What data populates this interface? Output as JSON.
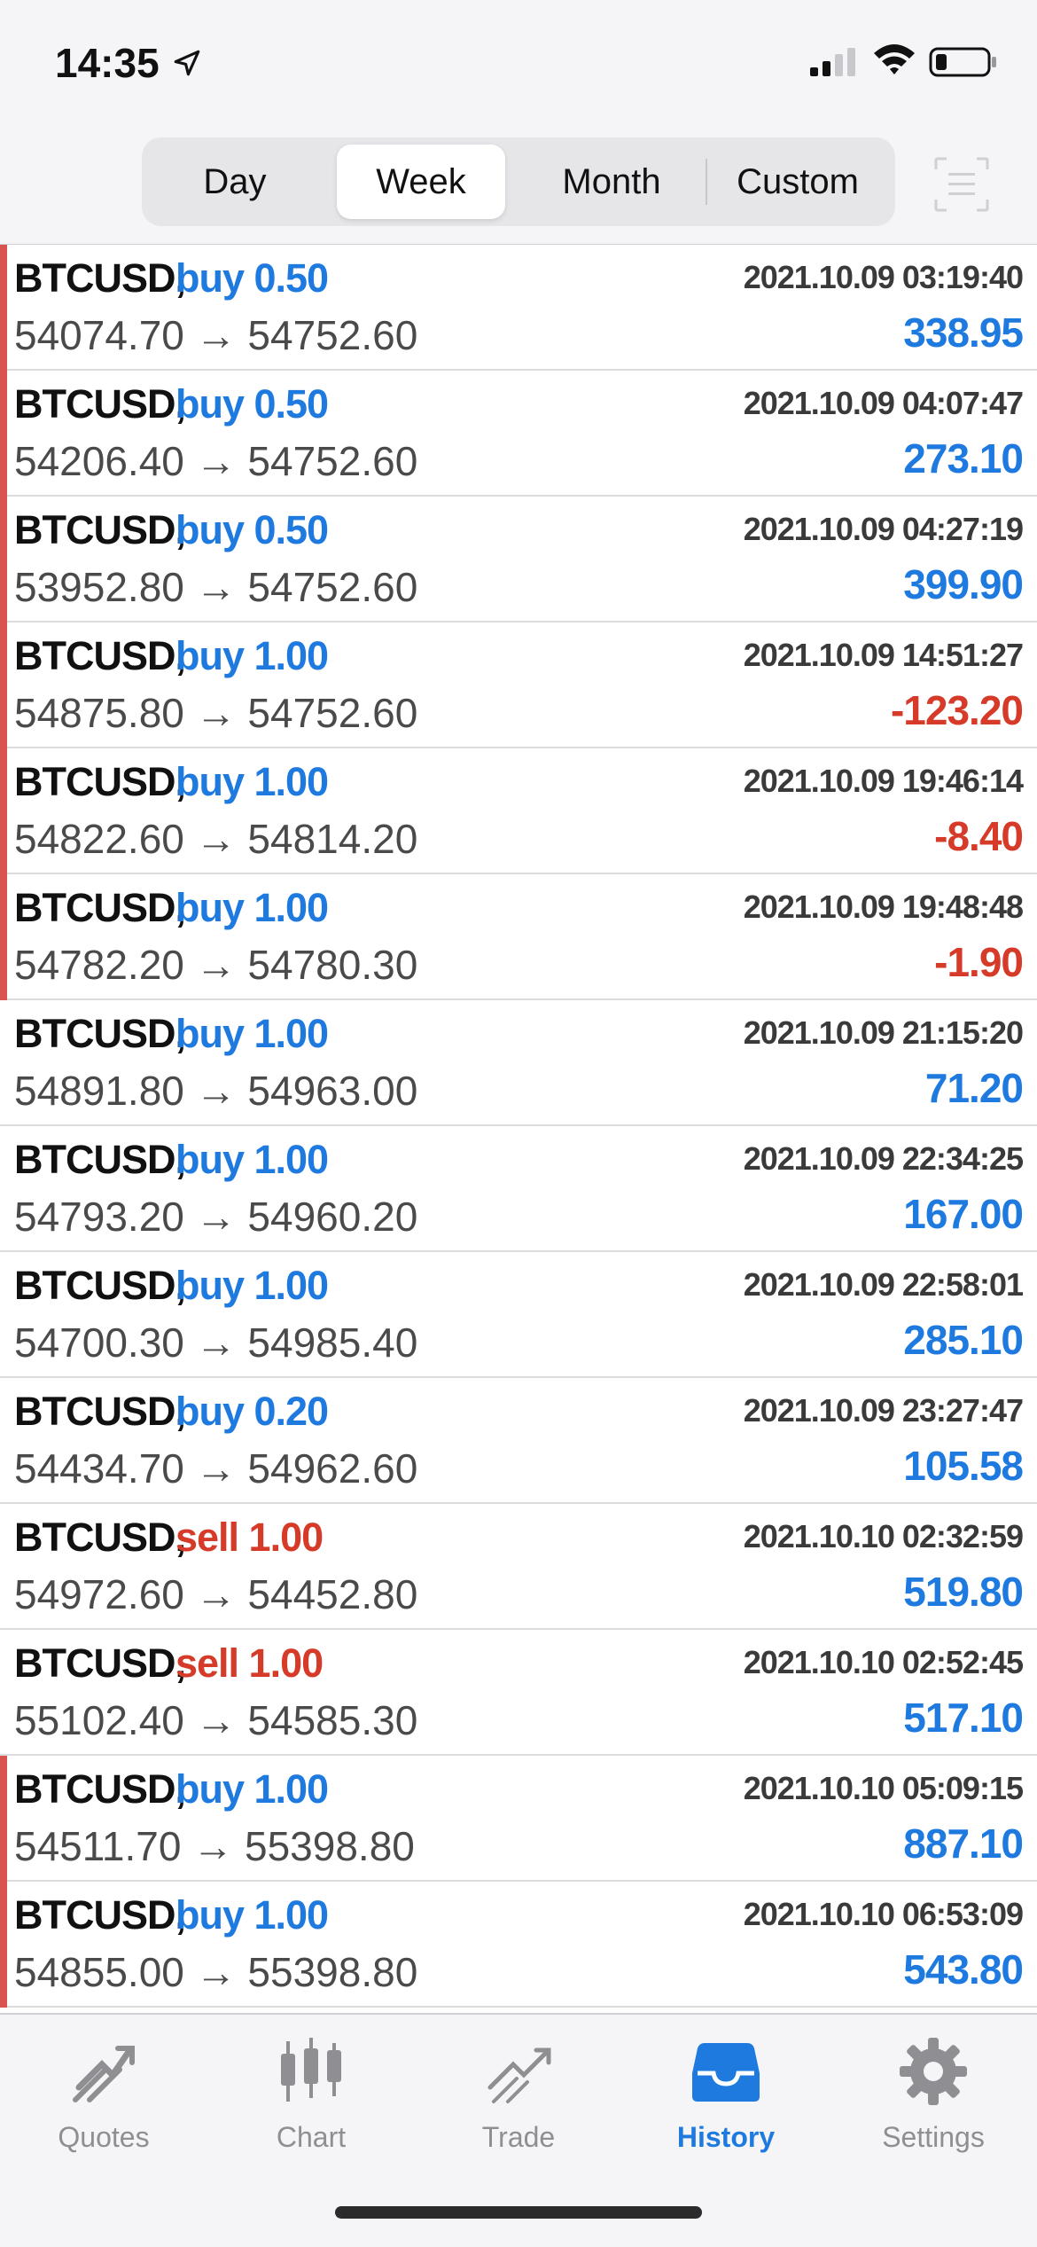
{
  "status_bar": {
    "time": "14:35"
  },
  "period_tabs": [
    {
      "label": "Day",
      "active": false
    },
    {
      "label": "Week",
      "active": true
    },
    {
      "label": "Month",
      "active": false
    },
    {
      "label": "Custom",
      "active": false
    }
  ],
  "deals": [
    {
      "symbol": "BTCUSD,",
      "type": "buy 0.50",
      "side": "buy",
      "prices": "54074.70 → 54752.60",
      "time": "2021.10.09 03:19:40",
      "profit": "338.95",
      "marker": true
    },
    {
      "symbol": "BTCUSD,",
      "type": "buy 0.50",
      "side": "buy",
      "prices": "54206.40 → 54752.60",
      "time": "2021.10.09 04:07:47",
      "profit": "273.10",
      "marker": true
    },
    {
      "symbol": "BTCUSD,",
      "type": "buy 0.50",
      "side": "buy",
      "prices": "53952.80 → 54752.60",
      "time": "2021.10.09 04:27:19",
      "profit": "399.90",
      "marker": true
    },
    {
      "symbol": "BTCUSD,",
      "type": "buy 1.00",
      "side": "buy",
      "prices": "54875.80 → 54752.60",
      "time": "2021.10.09 14:51:27",
      "profit": "-123.20",
      "marker": true
    },
    {
      "symbol": "BTCUSD,",
      "type": "buy 1.00",
      "side": "buy",
      "prices": "54822.60 → 54814.20",
      "time": "2021.10.09 19:46:14",
      "profit": "-8.40",
      "marker": true
    },
    {
      "symbol": "BTCUSD,",
      "type": "buy 1.00",
      "side": "buy",
      "prices": "54782.20 → 54780.30",
      "time": "2021.10.09 19:48:48",
      "profit": "-1.90",
      "marker": true
    },
    {
      "symbol": "BTCUSD,",
      "type": "buy 1.00",
      "side": "buy",
      "prices": "54891.80 → 54963.00",
      "time": "2021.10.09 21:15:20",
      "profit": "71.20",
      "marker": false
    },
    {
      "symbol": "BTCUSD,",
      "type": "buy 1.00",
      "side": "buy",
      "prices": "54793.20 → 54960.20",
      "time": "2021.10.09 22:34:25",
      "profit": "167.00",
      "marker": false
    },
    {
      "symbol": "BTCUSD,",
      "type": "buy 1.00",
      "side": "buy",
      "prices": "54700.30 → 54985.40",
      "time": "2021.10.09 22:58:01",
      "profit": "285.10",
      "marker": false
    },
    {
      "symbol": "BTCUSD,",
      "type": "buy 0.20",
      "side": "buy",
      "prices": "54434.70 → 54962.60",
      "time": "2021.10.09 23:27:47",
      "profit": "105.58",
      "marker": false
    },
    {
      "symbol": "BTCUSD,",
      "type": "sell 1.00",
      "side": "sell",
      "prices": "54972.60 → 54452.80",
      "time": "2021.10.10 02:32:59",
      "profit": "519.80",
      "marker": false
    },
    {
      "symbol": "BTCUSD,",
      "type": "sell 1.00",
      "side": "sell",
      "prices": "55102.40 → 54585.30",
      "time": "2021.10.10 02:52:45",
      "profit": "517.10",
      "marker": false
    },
    {
      "symbol": "BTCUSD,",
      "type": "buy 1.00",
      "side": "buy",
      "prices": "54511.70 → 55398.80",
      "time": "2021.10.10 05:09:15",
      "profit": "887.10",
      "marker": true
    },
    {
      "symbol": "BTCUSD,",
      "type": "buy 1.00",
      "side": "buy",
      "prices": "54855.00 → 55398.80",
      "time": "2021.10.10 06:53:09",
      "profit": "543.80",
      "marker": true
    }
  ],
  "tabs": [
    {
      "label": "Quotes",
      "icon": "quotes-icon",
      "active": false
    },
    {
      "label": "Chart",
      "icon": "chart-icon",
      "active": false
    },
    {
      "label": "Trade",
      "icon": "trade-icon",
      "active": false
    },
    {
      "label": "History",
      "icon": "history-icon",
      "active": true
    },
    {
      "label": "Settings",
      "icon": "gear-icon",
      "active": false
    }
  ],
  "colors": {
    "buy": "#1f7ae0",
    "sell": "#d63b2a",
    "marker": "#d9534f",
    "active_tab": "#1f7ae0"
  }
}
